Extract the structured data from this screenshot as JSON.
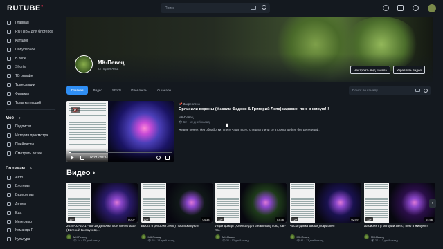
{
  "header": {
    "logo": "RUTUBE",
    "search_placeholder": "Поиск"
  },
  "sidebar": {
    "main": [
      {
        "label": "Главная",
        "icon": "home-icon"
      },
      {
        "label": "RUTUBE для блогеров",
        "icon": "blogger-icon"
      },
      {
        "label": "Каталог",
        "icon": "catalog-icon"
      },
      {
        "label": "Популярное",
        "icon": "fire-icon"
      },
      {
        "label": "В топе",
        "icon": "top-icon"
      },
      {
        "label": "Shorts",
        "icon": "shorts-icon"
      },
      {
        "label": "ТВ онлайн",
        "icon": "tv-icon"
      },
      {
        "label": "Трансляции",
        "icon": "broadcast-icon"
      },
      {
        "label": "Фильмы",
        "icon": "film-icon"
      },
      {
        "label": "Топы категорий",
        "icon": "categories-icon"
      }
    ],
    "mine_title": "Моё",
    "mine": [
      {
        "label": "Подписки",
        "icon": "subscriptions-icon"
      },
      {
        "label": "История просмотра",
        "icon": "history-icon"
      },
      {
        "label": "Плейлисты",
        "icon": "playlist-icon"
      },
      {
        "label": "Смотреть позже",
        "icon": "clock-icon"
      }
    ],
    "topics_title": "По темам",
    "topics": [
      {
        "label": "Авто",
        "icon": "car-icon"
      },
      {
        "label": "Блогеры",
        "icon": "blogger-icon"
      },
      {
        "label": "Видеоигры",
        "icon": "gamepad-icon"
      },
      {
        "label": "Детям",
        "icon": "kids-icon"
      },
      {
        "label": "Еда",
        "icon": "food-icon"
      },
      {
        "label": "Интервью",
        "icon": "microphone-icon"
      },
      {
        "label": "Команда R",
        "icon": "team-icon"
      },
      {
        "label": "Культура",
        "icon": "culture-icon"
      }
    ]
  },
  "channel": {
    "name": "МК-Певец",
    "subscribers": "22 подписчика",
    "customize_label": "Настроить вид канала",
    "manage_label": "Управлять видео"
  },
  "tabs": [
    {
      "label": "Главная",
      "active": true
    },
    {
      "label": "Видео",
      "active": false
    },
    {
      "label": "Shorts",
      "active": false
    },
    {
      "label": "Плейлисты",
      "active": false
    },
    {
      "label": "О канале",
      "active": false
    }
  ],
  "channel_search_placeholder": "Поиск по каналу",
  "featured": {
    "pinned": "Закреплено",
    "title": "Орлы или вороны (Максим Фадеев & Григорий Лепс) караоке, пою в живую!!!",
    "channel": "МК-Певец",
    "views": "62",
    "age": "13 дней назад",
    "description": "Живое пение, без обработки, спето чаще всего с первого или со второго дубля, без репетиций.",
    "time": "00:01 / 03:24",
    "progress": 0.005
  },
  "videos_section_title": "Видео",
  "videos": [
    {
      "title": "2025-03-20 17-55-19 Девочка моя синеглазая (Евгений Белоусов)...",
      "channel": "МК-Певец",
      "views": "14",
      "age": "13 дней назад",
      "duration": "00:07",
      "badge": "12+",
      "art": "#2a1a6a"
    },
    {
      "title": "Вьюга (Григорий Лепс) пою в живую!!!",
      "channel": "МК-Певец",
      "views": "76",
      "age": "13 дней назад",
      "duration": "04:38",
      "badge": "12+",
      "art": "#101818"
    },
    {
      "title": "Леди дождя (Александр Панайотов) пою, как-то...",
      "channel": "МК-Певец",
      "views": "30",
      "age": "13 дней назад",
      "duration": "03:36",
      "badge": "12+",
      "art": "#1e3a1a"
    },
    {
      "title": "Часы (Дима Билан) караоке!!",
      "channel": "МК-Певец",
      "views": "41",
      "age": "13 дней назад",
      "duration": "02:59",
      "badge": "12+",
      "art": "#1a1250"
    },
    {
      "title": "Лабиринт (Григорий Лепс) пою в живую!!!",
      "channel": "МК-Певец",
      "views": "27",
      "age": "13 дней назад",
      "duration": "04:56",
      "badge": "12+",
      "art": "#2a0e48"
    }
  ],
  "colors": {
    "accent": "#2f8ef4",
    "background": "#14191f",
    "logo_dot": "#ff2f52"
  }
}
